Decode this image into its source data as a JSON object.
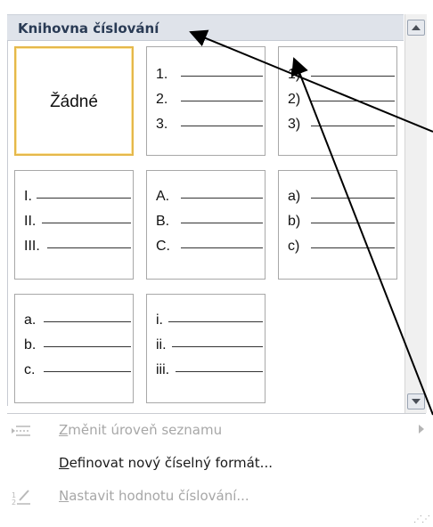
{
  "header": {
    "title": "Knihovna číslování"
  },
  "library": {
    "none": {
      "label": "Žádné"
    },
    "styles": [
      {
        "items": [
          "1.",
          "2.",
          "3."
        ]
      },
      {
        "items": [
          "1)",
          "2)",
          "3)"
        ]
      },
      {
        "items": [
          "I.",
          "II.",
          "III."
        ]
      },
      {
        "items": [
          "A.",
          "B.",
          "C."
        ]
      },
      {
        "items": [
          "a)",
          "b)",
          "c)"
        ]
      },
      {
        "items": [
          "a.",
          "b.",
          "c."
        ]
      },
      {
        "items": [
          "i.",
          "ii.",
          "iii."
        ]
      }
    ]
  },
  "menu": {
    "change_level": {
      "accel": "Z",
      "rest": "měnit úroveň seznamu",
      "enabled": false
    },
    "define_format": {
      "accel": "D",
      "rest": "efinovat nový číselný formát...",
      "enabled": true
    },
    "set_value": {
      "accel": "N",
      "rest": "astavit hodnotu číslování...",
      "enabled": false
    }
  },
  "colors": {
    "selected_border": "#e5b84a",
    "header_bg": "#dfe3ea",
    "disabled_text": "#a7a7a7"
  }
}
